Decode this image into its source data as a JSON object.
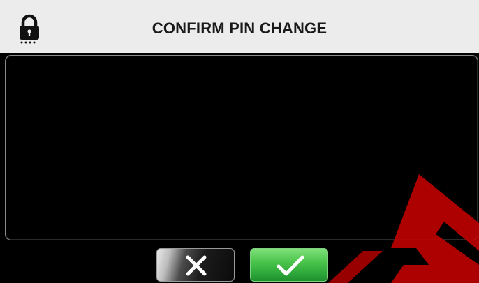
{
  "header": {
    "title": "CONFIRM PIN CHANGE",
    "icon": "lock-icon"
  },
  "buttons": {
    "cancel_icon": "close-icon",
    "confirm_icon": "checkmark-icon"
  },
  "colors": {
    "header_bg": "#ececec",
    "screen_bg": "#000000",
    "confirm_green": "#3dba45",
    "watermark_red": "#cc0000"
  }
}
